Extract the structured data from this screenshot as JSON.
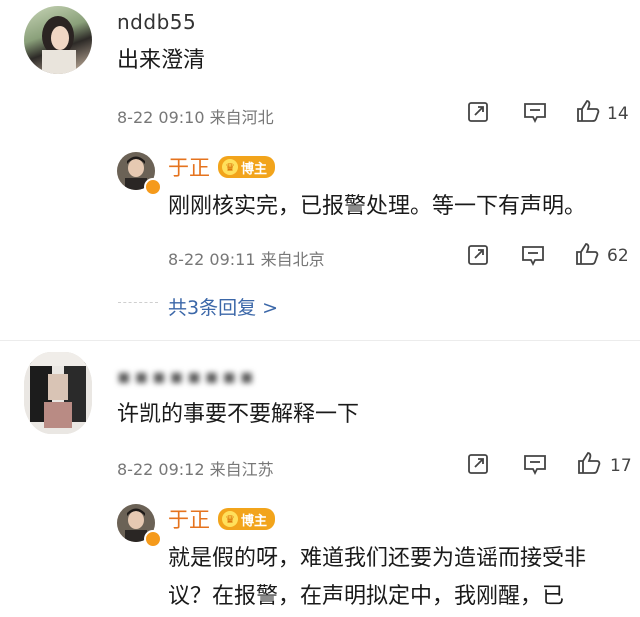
{
  "comments": [
    {
      "username": "nddb55",
      "text": "出来澄清",
      "date": "8-22",
      "time": "09:10",
      "location": "来自河北",
      "likes": "14",
      "reply": {
        "username": "于正",
        "badge": "博主",
        "text": "刚刚核实完，已报警处理。等一下有声明。",
        "date": "8-22",
        "time": "09:11",
        "location": "来自北京",
        "likes": "62"
      },
      "more_replies": "共3条回复 >"
    },
    {
      "username": "▪▪▪▪▪▪▪▪",
      "text": "许凯的事要不要解释一下",
      "date": "8-22",
      "time": "09:12",
      "location": "来自江苏",
      "likes": "17",
      "reply": {
        "username": "于正",
        "badge": "博主",
        "text_line1": "就是假的呀，难道我们还要为造谣而接受非",
        "text_line2": "议？在报警，在声明拟定中，我刚醒，已"
      }
    }
  ],
  "colors": {
    "accent_name": "#e5731e",
    "badge": "#f2a41b",
    "link": "#3b67a8"
  },
  "icons": [
    "share-icon",
    "comment-icon",
    "like-icon",
    "crown-icon"
  ]
}
